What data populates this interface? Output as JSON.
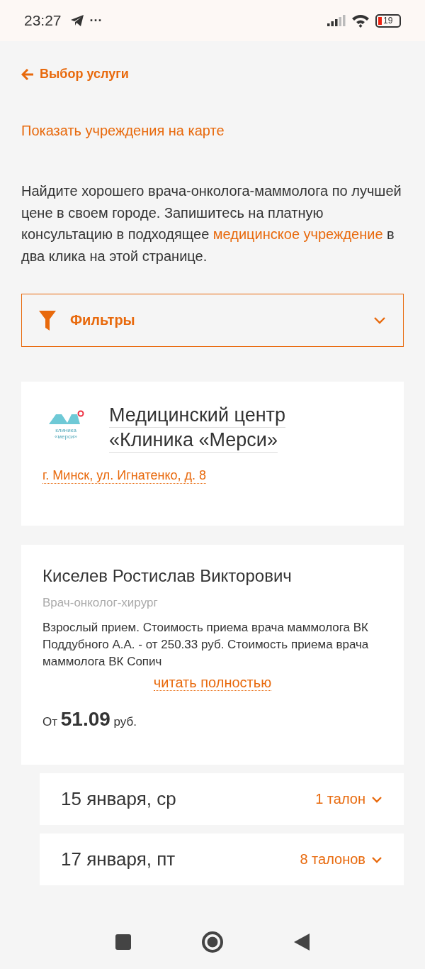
{
  "status_bar": {
    "time": "23:27",
    "more": "···",
    "battery": "19"
  },
  "back_link": {
    "label": "Выбор услуги"
  },
  "map_link": {
    "label": "Показать учреждения на карте"
  },
  "intro": {
    "before": "Найдите хорошего врача-онколога-маммолога по лучшей цене в своем городе. Запишитесь на платную консультацию в подходящее ",
    "link": "медицинское учреждение",
    "after": " в два клика на этой странице."
  },
  "filters": {
    "label": "Фильтры",
    "expanded": false
  },
  "clinic": {
    "logo_text": [
      "клиника",
      "«мерси»"
    ],
    "name_lines": [
      "Медицинский центр",
      "«Клиника «Мерси»"
    ],
    "address": "г. Минск, ул. Игнатенко, д. 8"
  },
  "doctor": {
    "name": "Киселев Ростислав Викторович",
    "specialty": "Врач-онколог-хирург",
    "description": "Взрослый прием. Стоимость приема врача маммолога ВК Поддубного А.А. - от 250.33 руб. Стоимость приема врача маммолога ВК Сопич",
    "read_more": "читать полностью",
    "price_prefix": "От",
    "price": "51.09",
    "price_unit": "руб."
  },
  "dates": [
    {
      "date": "15 января, ср",
      "slots": "1 талон",
      "expanded": false
    },
    {
      "date": "17 января, пт",
      "slots": "8 талонов",
      "expanded": false
    }
  ]
}
